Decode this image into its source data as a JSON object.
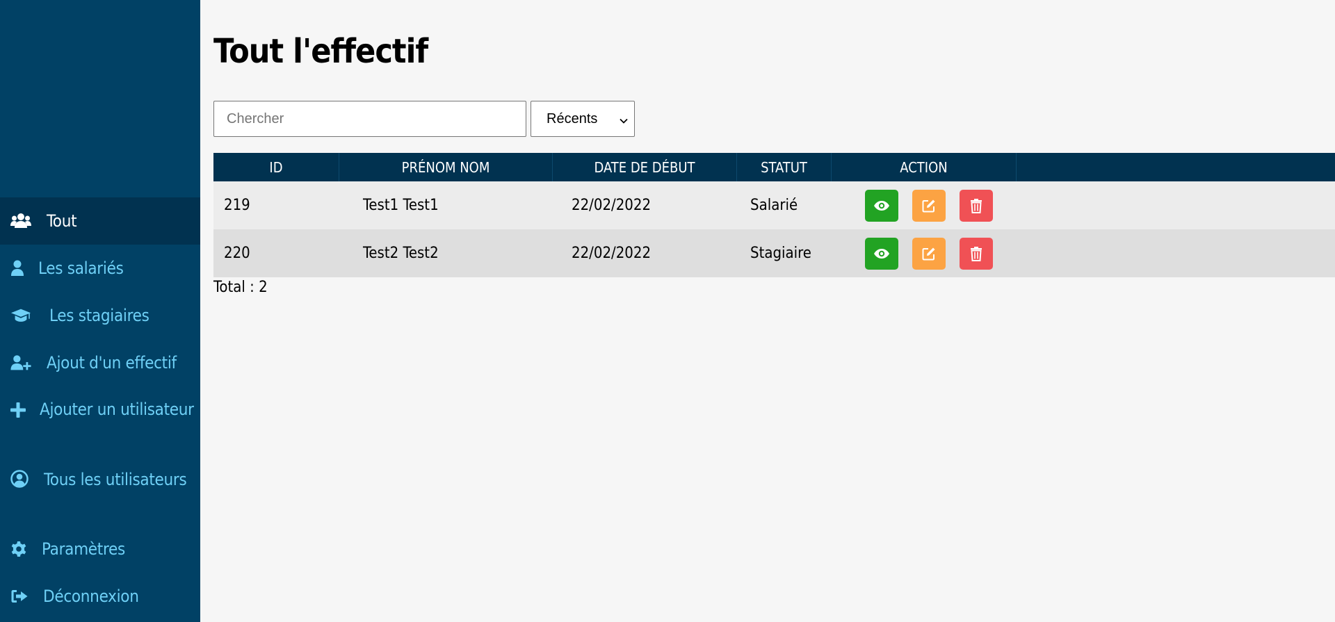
{
  "sidebar": {
    "items": [
      {
        "label": "Tout",
        "icon": "users-icon",
        "active": true
      },
      {
        "label": "Les salariés",
        "icon": "user-icon",
        "active": false
      },
      {
        "label": "Les stagiaires",
        "icon": "graduation-cap-icon",
        "active": false
      },
      {
        "label": "Ajout d'un effectif",
        "icon": "user-plus-icon",
        "active": false
      },
      {
        "label": "Ajouter un utilisateur",
        "icon": "plus-icon",
        "active": false
      },
      {
        "label": "Tous les utilisateurs",
        "icon": "user-circle-icon",
        "active": false
      },
      {
        "label": "Paramètres",
        "icon": "gear-icon",
        "active": false
      },
      {
        "label": "Déconnexion",
        "icon": "sign-out-icon",
        "active": false
      }
    ]
  },
  "main": {
    "title": "Tout l'effectif",
    "search": {
      "placeholder": "Chercher",
      "value": ""
    },
    "sort": {
      "selected": "Récents"
    },
    "table": {
      "headers": [
        "ID",
        "PRÉNOM NOM",
        "DATE DE DÉBUT",
        "STATUT",
        "ACTION"
      ],
      "rows": [
        {
          "id": "219",
          "name": "Test1 Test1",
          "date": "22/02/2022",
          "status": "Salarié"
        },
        {
          "id": "220",
          "name": "Test2 Test2",
          "date": "22/02/2022",
          "status": "Stagiaire"
        }
      ]
    },
    "total": "Total : 2"
  },
  "colors": {
    "sidebar_bg": "#014165",
    "sidebar_active_bg": "#013250",
    "sidebar_text": "#6fd0f6",
    "table_header_bg": "#013250",
    "view_button": "#22a323",
    "edit_button": "#fca343",
    "delete_button": "#f05155"
  }
}
